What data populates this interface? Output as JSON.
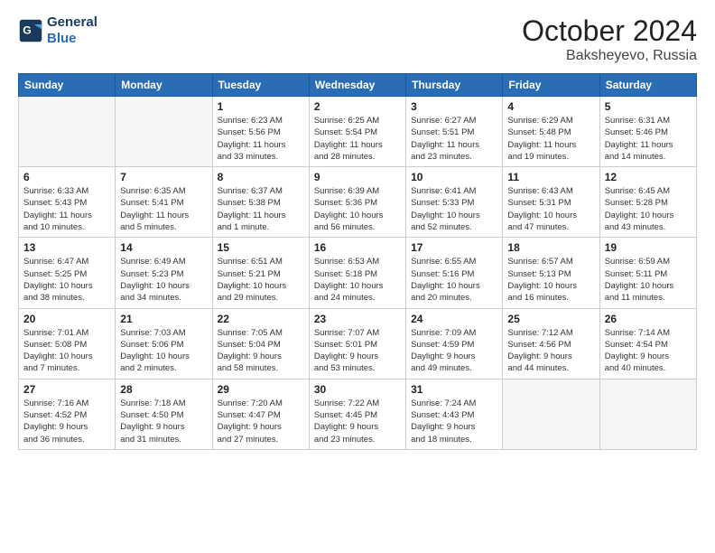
{
  "header": {
    "logo_line1": "General",
    "logo_line2": "Blue",
    "month": "October 2024",
    "location": "Baksheyevo, Russia"
  },
  "weekdays": [
    "Sunday",
    "Monday",
    "Tuesday",
    "Wednesday",
    "Thursday",
    "Friday",
    "Saturday"
  ],
  "weeks": [
    [
      {
        "day": "",
        "info": ""
      },
      {
        "day": "",
        "info": ""
      },
      {
        "day": "1",
        "info": "Sunrise: 6:23 AM\nSunset: 5:56 PM\nDaylight: 11 hours\nand 33 minutes."
      },
      {
        "day": "2",
        "info": "Sunrise: 6:25 AM\nSunset: 5:54 PM\nDaylight: 11 hours\nand 28 minutes."
      },
      {
        "day": "3",
        "info": "Sunrise: 6:27 AM\nSunset: 5:51 PM\nDaylight: 11 hours\nand 23 minutes."
      },
      {
        "day": "4",
        "info": "Sunrise: 6:29 AM\nSunset: 5:48 PM\nDaylight: 11 hours\nand 19 minutes."
      },
      {
        "day": "5",
        "info": "Sunrise: 6:31 AM\nSunset: 5:46 PM\nDaylight: 11 hours\nand 14 minutes."
      }
    ],
    [
      {
        "day": "6",
        "info": "Sunrise: 6:33 AM\nSunset: 5:43 PM\nDaylight: 11 hours\nand 10 minutes."
      },
      {
        "day": "7",
        "info": "Sunrise: 6:35 AM\nSunset: 5:41 PM\nDaylight: 11 hours\nand 5 minutes."
      },
      {
        "day": "8",
        "info": "Sunrise: 6:37 AM\nSunset: 5:38 PM\nDaylight: 11 hours\nand 1 minute."
      },
      {
        "day": "9",
        "info": "Sunrise: 6:39 AM\nSunset: 5:36 PM\nDaylight: 10 hours\nand 56 minutes."
      },
      {
        "day": "10",
        "info": "Sunrise: 6:41 AM\nSunset: 5:33 PM\nDaylight: 10 hours\nand 52 minutes."
      },
      {
        "day": "11",
        "info": "Sunrise: 6:43 AM\nSunset: 5:31 PM\nDaylight: 10 hours\nand 47 minutes."
      },
      {
        "day": "12",
        "info": "Sunrise: 6:45 AM\nSunset: 5:28 PM\nDaylight: 10 hours\nand 43 minutes."
      }
    ],
    [
      {
        "day": "13",
        "info": "Sunrise: 6:47 AM\nSunset: 5:25 PM\nDaylight: 10 hours\nand 38 minutes."
      },
      {
        "day": "14",
        "info": "Sunrise: 6:49 AM\nSunset: 5:23 PM\nDaylight: 10 hours\nand 34 minutes."
      },
      {
        "day": "15",
        "info": "Sunrise: 6:51 AM\nSunset: 5:21 PM\nDaylight: 10 hours\nand 29 minutes."
      },
      {
        "day": "16",
        "info": "Sunrise: 6:53 AM\nSunset: 5:18 PM\nDaylight: 10 hours\nand 24 minutes."
      },
      {
        "day": "17",
        "info": "Sunrise: 6:55 AM\nSunset: 5:16 PM\nDaylight: 10 hours\nand 20 minutes."
      },
      {
        "day": "18",
        "info": "Sunrise: 6:57 AM\nSunset: 5:13 PM\nDaylight: 10 hours\nand 16 minutes."
      },
      {
        "day": "19",
        "info": "Sunrise: 6:59 AM\nSunset: 5:11 PM\nDaylight: 10 hours\nand 11 minutes."
      }
    ],
    [
      {
        "day": "20",
        "info": "Sunrise: 7:01 AM\nSunset: 5:08 PM\nDaylight: 10 hours\nand 7 minutes."
      },
      {
        "day": "21",
        "info": "Sunrise: 7:03 AM\nSunset: 5:06 PM\nDaylight: 10 hours\nand 2 minutes."
      },
      {
        "day": "22",
        "info": "Sunrise: 7:05 AM\nSunset: 5:04 PM\nDaylight: 9 hours\nand 58 minutes."
      },
      {
        "day": "23",
        "info": "Sunrise: 7:07 AM\nSunset: 5:01 PM\nDaylight: 9 hours\nand 53 minutes."
      },
      {
        "day": "24",
        "info": "Sunrise: 7:09 AM\nSunset: 4:59 PM\nDaylight: 9 hours\nand 49 minutes."
      },
      {
        "day": "25",
        "info": "Sunrise: 7:12 AM\nSunset: 4:56 PM\nDaylight: 9 hours\nand 44 minutes."
      },
      {
        "day": "26",
        "info": "Sunrise: 7:14 AM\nSunset: 4:54 PM\nDaylight: 9 hours\nand 40 minutes."
      }
    ],
    [
      {
        "day": "27",
        "info": "Sunrise: 7:16 AM\nSunset: 4:52 PM\nDaylight: 9 hours\nand 36 minutes."
      },
      {
        "day": "28",
        "info": "Sunrise: 7:18 AM\nSunset: 4:50 PM\nDaylight: 9 hours\nand 31 minutes."
      },
      {
        "day": "29",
        "info": "Sunrise: 7:20 AM\nSunset: 4:47 PM\nDaylight: 9 hours\nand 27 minutes."
      },
      {
        "day": "30",
        "info": "Sunrise: 7:22 AM\nSunset: 4:45 PM\nDaylight: 9 hours\nand 23 minutes."
      },
      {
        "day": "31",
        "info": "Sunrise: 7:24 AM\nSunset: 4:43 PM\nDaylight: 9 hours\nand 18 minutes."
      },
      {
        "day": "",
        "info": ""
      },
      {
        "day": "",
        "info": ""
      }
    ]
  ]
}
